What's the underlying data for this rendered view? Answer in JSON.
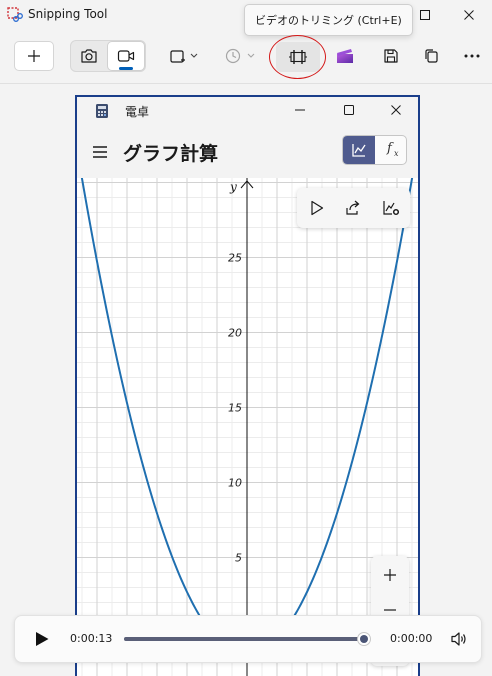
{
  "app": {
    "title": "Snipping Tool"
  },
  "tooltip": {
    "text": "ビデオのトリミング (Ctrl+E)"
  },
  "toolbar": {
    "new_icon": "plus-icon",
    "screenshot_mode_icon": "camera-icon",
    "video_mode_icon": "video-camera-icon",
    "selected_mode": "video",
    "shape_icon": "rectangle-snip-icon",
    "delay_icon": "clock-icon",
    "trim_icon": "trim-video-icon",
    "clipchamp_icon": "clipchamp-icon",
    "save_icon": "save-icon",
    "copy_icon": "copy-icon",
    "more_icon": "more-icon"
  },
  "calculator": {
    "window_title": "電卓",
    "heading": "グラフ計算",
    "y_axis_label": "y",
    "y_ticks": [
      "25",
      "20",
      "15",
      "10",
      "5"
    ],
    "mode_graph_icon": "graph-icon",
    "mode_function_label": "f",
    "mode_function_sub": "x"
  },
  "player": {
    "current_time": "0:00:13",
    "end_time": "0:00:00",
    "progress_percent": 99
  },
  "colors": {
    "accent": "#005fb8",
    "highlight_circle": "#d41b1b",
    "curve": "#1f6fb0",
    "capture_border": "#1a3e8a",
    "mode_active": "#4f5b8e"
  }
}
